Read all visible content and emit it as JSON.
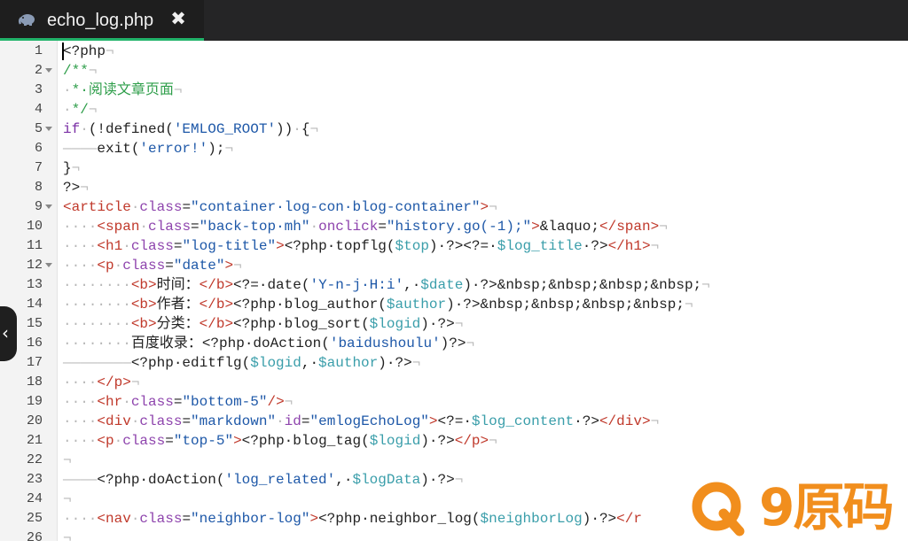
{
  "tab": {
    "title": "echo_log.php",
    "close_label": "✖",
    "icon": "elephant-icon"
  },
  "side": {
    "toggle_label": "‹",
    "icon": "chevron-left-icon"
  },
  "watermark": {
    "text": "9原码"
  },
  "colors": {
    "tag": "#c0392b",
    "attr": "#8e44ad",
    "string": "#1e58a8",
    "variable": "#3a9eaa",
    "comment": "#2e9e4a",
    "keyword": "#7a2fa5",
    "accent": "#21b36a",
    "watermark": "#f18e1d"
  },
  "lines": [
    {
      "n": "1",
      "fold": false,
      "tokens": [
        [
          "t",
          "<?php"
        ],
        [
          "ws",
          "¬"
        ]
      ]
    },
    {
      "n": "2",
      "fold": true,
      "tokens": [
        [
          "c",
          "/**"
        ],
        [
          "ws",
          "¬"
        ]
      ]
    },
    {
      "n": "3",
      "fold": false,
      "tokens": [
        [
          "ws",
          "·"
        ],
        [
          "c",
          "*·阅读文章页面"
        ],
        [
          "ws",
          "¬"
        ]
      ]
    },
    {
      "n": "4",
      "fold": false,
      "tokens": [
        [
          "ws",
          "·"
        ],
        [
          "c",
          "*/"
        ],
        [
          "ws",
          "¬"
        ]
      ]
    },
    {
      "n": "5",
      "fold": true,
      "tokens": [
        [
          "k",
          "if"
        ],
        [
          "ws",
          "·"
        ],
        [
          "t",
          "(!defined("
        ],
        [
          "s",
          "'EMLOG_ROOT'"
        ],
        [
          "t",
          "))"
        ],
        [
          "ws",
          "·"
        ],
        [
          "t",
          "{"
        ],
        [
          "ws",
          "¬"
        ]
      ]
    },
    {
      "n": "6",
      "fold": false,
      "tokens": [
        [
          "ws",
          "————"
        ],
        [
          "t",
          "exit("
        ],
        [
          "s",
          "'error!'"
        ],
        [
          "t",
          ");"
        ],
        [
          "ws",
          "¬"
        ]
      ]
    },
    {
      "n": "7",
      "fold": false,
      "tokens": [
        [
          "t",
          "}"
        ],
        [
          "ws",
          "¬"
        ]
      ]
    },
    {
      "n": "8",
      "fold": false,
      "tokens": [
        [
          "t",
          "?>"
        ],
        [
          "ws",
          "¬"
        ]
      ]
    },
    {
      "n": "9",
      "fold": true,
      "tokens": [
        [
          "g",
          "<article"
        ],
        [
          "ws",
          "·"
        ],
        [
          "a",
          "class"
        ],
        [
          "t",
          "="
        ],
        [
          "s",
          "\"container·log-con·blog-container\""
        ],
        [
          "g",
          ">"
        ],
        [
          "ws",
          "¬"
        ]
      ]
    },
    {
      "n": "10",
      "fold": false,
      "tokens": [
        [
          "ws",
          "····"
        ],
        [
          "g",
          "<span"
        ],
        [
          "ws",
          "·"
        ],
        [
          "a",
          "class"
        ],
        [
          "t",
          "="
        ],
        [
          "s",
          "\"back-top·mh\""
        ],
        [
          "ws",
          "·"
        ],
        [
          "a",
          "onclick"
        ],
        [
          "t",
          "="
        ],
        [
          "s",
          "\"history.go(-1);\""
        ],
        [
          "g",
          ">"
        ],
        [
          "t",
          "&laquo;"
        ],
        [
          "g",
          "</span>"
        ],
        [
          "ws",
          "¬"
        ]
      ]
    },
    {
      "n": "11",
      "fold": false,
      "tokens": [
        [
          "ws",
          "····"
        ],
        [
          "g",
          "<h1"
        ],
        [
          "ws",
          "·"
        ],
        [
          "a",
          "class"
        ],
        [
          "t",
          "="
        ],
        [
          "s",
          "\"log-title\""
        ],
        [
          "g",
          ">"
        ],
        [
          "t",
          "<?php·topflg("
        ],
        [
          "v",
          "$top"
        ],
        [
          "t",
          ")·?><?=·"
        ],
        [
          "v",
          "$log_title"
        ],
        [
          "t",
          "·?>"
        ],
        [
          "g",
          "</h1>"
        ],
        [
          "ws",
          "¬"
        ]
      ]
    },
    {
      "n": "12",
      "fold": true,
      "tokens": [
        [
          "ws",
          "····"
        ],
        [
          "g",
          "<p"
        ],
        [
          "ws",
          "·"
        ],
        [
          "a",
          "class"
        ],
        [
          "t",
          "="
        ],
        [
          "s",
          "\"date\""
        ],
        [
          "g",
          ">"
        ],
        [
          "ws",
          "¬"
        ]
      ]
    },
    {
      "n": "13",
      "fold": false,
      "tokens": [
        [
          "ws",
          "········"
        ],
        [
          "g",
          "<b>"
        ],
        [
          "t",
          "时间："
        ],
        [
          "g",
          "</b>"
        ],
        [
          "t",
          "<?=·date("
        ],
        [
          "s",
          "'Y-n-j·H:i'"
        ],
        [
          "t",
          ",·"
        ],
        [
          "v",
          "$date"
        ],
        [
          "t",
          ")·?>&nbsp;&nbsp;&nbsp;&nbsp;"
        ],
        [
          "ws",
          "¬"
        ]
      ]
    },
    {
      "n": "14",
      "fold": false,
      "tokens": [
        [
          "ws",
          "········"
        ],
        [
          "g",
          "<b>"
        ],
        [
          "t",
          "作者："
        ],
        [
          "g",
          "</b>"
        ],
        [
          "t",
          "<?php·blog_author("
        ],
        [
          "v",
          "$author"
        ],
        [
          "t",
          ")·?>&nbsp;&nbsp;&nbsp;&nbsp;"
        ],
        [
          "ws",
          "¬"
        ]
      ]
    },
    {
      "n": "15",
      "fold": false,
      "tokens": [
        [
          "ws",
          "········"
        ],
        [
          "g",
          "<b>"
        ],
        [
          "t",
          "分类："
        ],
        [
          "g",
          "</b>"
        ],
        [
          "t",
          "<?php·blog_sort("
        ],
        [
          "v",
          "$logid"
        ],
        [
          "t",
          ")·?>"
        ],
        [
          "ws",
          "¬"
        ]
      ]
    },
    {
      "n": "16",
      "fold": false,
      "tokens": [
        [
          "ws",
          "········"
        ],
        [
          "t",
          "百度收录：<?php·doAction("
        ],
        [
          "s",
          "'baidushoulu'"
        ],
        [
          "t",
          ")?>"
        ],
        [
          "ws",
          "¬"
        ]
      ]
    },
    {
      "n": "17",
      "fold": false,
      "tokens": [
        [
          "ws",
          "————————"
        ],
        [
          "t",
          "<?php·editflg("
        ],
        [
          "v",
          "$logid"
        ],
        [
          "t",
          ",·"
        ],
        [
          "v",
          "$author"
        ],
        [
          "t",
          ")·?>"
        ],
        [
          "ws",
          "¬"
        ]
      ]
    },
    {
      "n": "18",
      "fold": false,
      "tokens": [
        [
          "ws",
          "····"
        ],
        [
          "g",
          "</p>"
        ],
        [
          "ws",
          "¬"
        ]
      ]
    },
    {
      "n": "19",
      "fold": false,
      "tokens": [
        [
          "ws",
          "····"
        ],
        [
          "g",
          "<hr"
        ],
        [
          "ws",
          "·"
        ],
        [
          "a",
          "class"
        ],
        [
          "t",
          "="
        ],
        [
          "s",
          "\"bottom-5\""
        ],
        [
          "g",
          "/>"
        ],
        [
          "ws",
          "¬"
        ]
      ]
    },
    {
      "n": "20",
      "fold": false,
      "tokens": [
        [
          "ws",
          "····"
        ],
        [
          "g",
          "<div"
        ],
        [
          "ws",
          "·"
        ],
        [
          "a",
          "class"
        ],
        [
          "t",
          "="
        ],
        [
          "s",
          "\"markdown\""
        ],
        [
          "ws",
          "·"
        ],
        [
          "a",
          "id"
        ],
        [
          "t",
          "="
        ],
        [
          "s",
          "\"emlogEchoLog\""
        ],
        [
          "g",
          ">"
        ],
        [
          "t",
          "<?=·"
        ],
        [
          "v",
          "$log_content"
        ],
        [
          "t",
          "·?>"
        ],
        [
          "g",
          "</div>"
        ],
        [
          "ws",
          "¬"
        ]
      ]
    },
    {
      "n": "21",
      "fold": false,
      "tokens": [
        [
          "ws",
          "····"
        ],
        [
          "g",
          "<p"
        ],
        [
          "ws",
          "·"
        ],
        [
          "a",
          "class"
        ],
        [
          "t",
          "="
        ],
        [
          "s",
          "\"top-5\""
        ],
        [
          "g",
          ">"
        ],
        [
          "t",
          "<?php·blog_tag("
        ],
        [
          "v",
          "$logid"
        ],
        [
          "t",
          ")·?>"
        ],
        [
          "g",
          "</p>"
        ],
        [
          "ws",
          "¬"
        ]
      ]
    },
    {
      "n": "22",
      "fold": false,
      "tokens": [
        [
          "ws",
          "¬"
        ]
      ]
    },
    {
      "n": "23",
      "fold": false,
      "tokens": [
        [
          "ws",
          "————"
        ],
        [
          "t",
          "<?php·doAction("
        ],
        [
          "s",
          "'log_related'"
        ],
        [
          "t",
          ",·"
        ],
        [
          "v",
          "$logData"
        ],
        [
          "t",
          ")·?>"
        ],
        [
          "ws",
          "¬"
        ]
      ]
    },
    {
      "n": "24",
      "fold": false,
      "tokens": [
        [
          "ws",
          "¬"
        ]
      ]
    },
    {
      "n": "25",
      "fold": false,
      "tokens": [
        [
          "ws",
          "····"
        ],
        [
          "g",
          "<nav"
        ],
        [
          "ws",
          "·"
        ],
        [
          "a",
          "class"
        ],
        [
          "t",
          "="
        ],
        [
          "s",
          "\"neighbor-log\""
        ],
        [
          "g",
          ">"
        ],
        [
          "t",
          "<?php·neighbor_log("
        ],
        [
          "v",
          "$neighborLog"
        ],
        [
          "t",
          ")·?>"
        ],
        [
          "g",
          "</r"
        ]
      ]
    },
    {
      "n": "26",
      "fold": false,
      "tokens": [
        [
          "ws",
          "¬"
        ]
      ]
    }
  ]
}
